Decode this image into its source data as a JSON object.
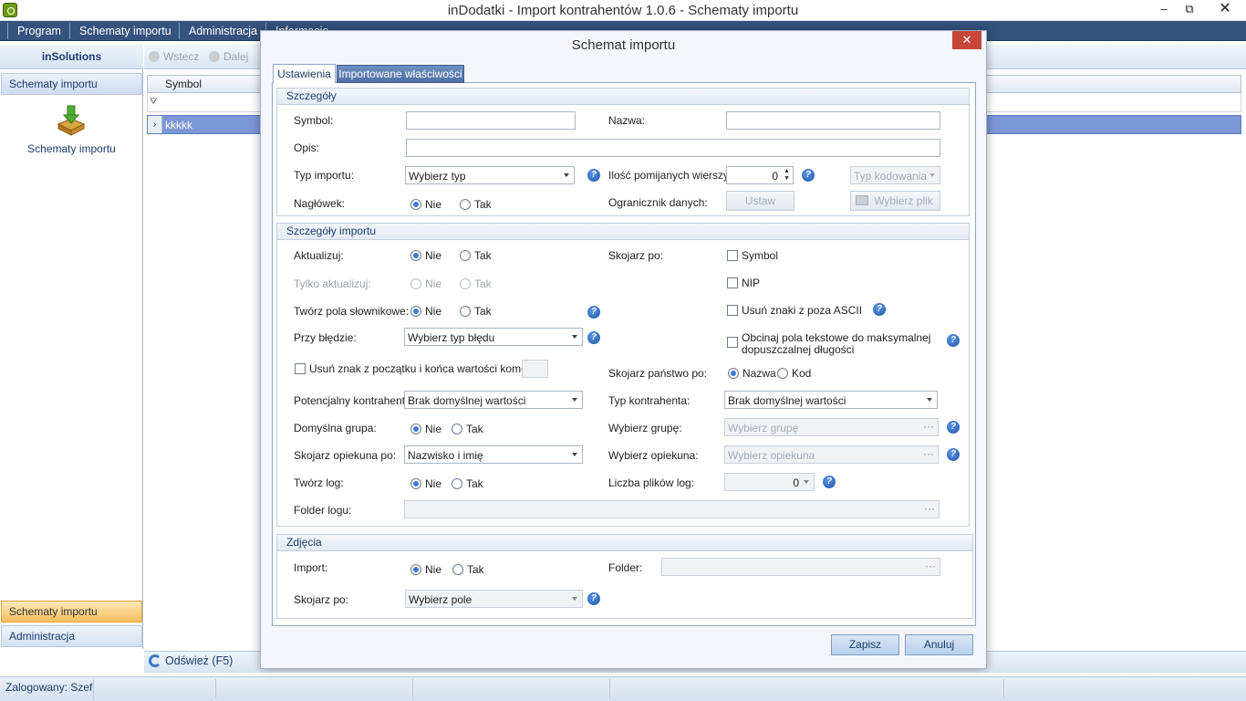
{
  "window": {
    "title": "inDodatki - Import kontrahentów 1.0.6 - Schematy importu",
    "controls": {
      "minimize": "–",
      "restore": "⧉",
      "close": "✕"
    }
  },
  "menu": [
    "Program",
    "Schematy importu",
    "Administracja",
    "Informacje"
  ],
  "nav": {
    "header": "inSolutions",
    "group_top": "Schematy importu",
    "icon_label": "Schematy importu",
    "group_active": "Schematy importu",
    "group_admin": "Administracja"
  },
  "toolbar": {
    "back": "Wstecz",
    "next": "Dalej"
  },
  "grid": {
    "column": "Symbol",
    "filter_icon": "filter-icon",
    "rows": [
      {
        "indicator": "›",
        "symbol": "kkkkk"
      }
    ]
  },
  "bottom": {
    "refresh": "Odśwież (F5)"
  },
  "status": {
    "logged": "Zalogowany: Szef"
  },
  "dialog": {
    "title": "Schemat importu",
    "close": "✕",
    "tabs": [
      "Ustawienia",
      "Importowane właściwości"
    ],
    "details": {
      "header": "Szczegóły",
      "symbol_label": "Symbol:",
      "symbol_value": "",
      "name_label": "Nazwa:",
      "name_value": "",
      "desc_label": "Opis:",
      "desc_value": "",
      "import_type_label": "Typ importu:",
      "import_type_value": "Wybierz typ",
      "skip_rows_label": "Ilość pomijanych wierszy:",
      "skip_rows_value": "0",
      "encoding_value": "Typ kodowania",
      "header_label": "Nagłówek:",
      "delimiters_label": "Ogranicznik danych:",
      "set_button": "Ustaw",
      "choose_file_button": "Wybierz plik"
    },
    "import_details": {
      "header": "Szczegóły importu",
      "update_label": "Aktualizuj:",
      "only_update_label": "Tylko aktualizuj:",
      "dict_fields_label": "Twórz pola słownikowe:",
      "on_error_label": "Przy błędzie:",
      "on_error_value": "Wybierz typ błędu",
      "trim_label": "Usuń znak z początku i końca wartości komórki",
      "trim_value": "",
      "potential_label": "Potencjalny kontrahent:",
      "potential_value": "Brak domyślnej wartości",
      "default_group_label": "Domyślna grupa:",
      "guardian_match_label": "Skojarz opiekuna po:",
      "guardian_match_value": "Nazwisko i imię",
      "log_label": "Twórz log:",
      "log_folder_label": "Folder logu:",
      "log_folder_value": "",
      "match_by_label": "Skojarz po:",
      "match_symbol": "Symbol",
      "match_nip": "NIP",
      "remove_ascii": "Usuń znaki z poza ASCII",
      "truncate_line1": "Obcinaj pola tekstowe do maksymalnej",
      "truncate_line2": "dopuszczalnej długości",
      "country_match_label": "Skojarz państwo po:",
      "country_name": "Nazwa",
      "country_code": "Kod",
      "contractor_type_label": "Typ kontrahenta:",
      "contractor_type_value": "Brak domyślnej wartości",
      "choose_group_label": "Wybierz grupę:",
      "choose_group_value": "Wybierz grupę",
      "choose_guardian_label": "Wybierz opiekuna:",
      "choose_guardian_value": "Wybierz opiekuna",
      "log_count_label": "Liczba plików log:",
      "log_count_value": "0"
    },
    "photos": {
      "header": "Zdjęcia",
      "import_label": "Import:",
      "folder_label": "Folder:",
      "folder_value": "",
      "match_label": "Skojarz po:",
      "match_value": "Wybierz pole"
    },
    "yes": "Tak",
    "no": "Nie",
    "help": "?",
    "dots": "···",
    "save": "Zapisz",
    "cancel": "Anuluj"
  }
}
